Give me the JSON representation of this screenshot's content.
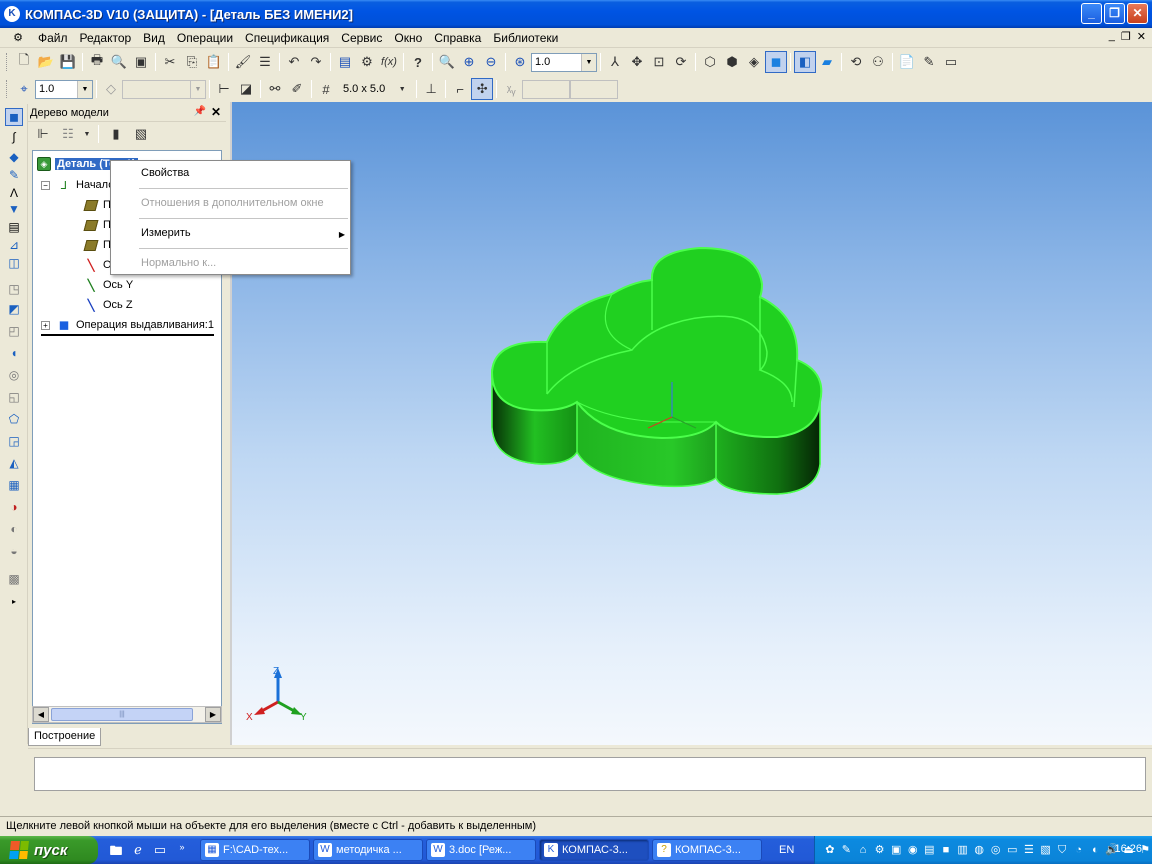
{
  "window": {
    "title": "КОМПАС-3D V10 (ЗАЩИТА) - [Деталь БЕЗ ИМЕНИ2]",
    "app_icon": "K"
  },
  "menu": {
    "items": [
      "Файл",
      "Редактор",
      "Вид",
      "Операции",
      "Спецификация",
      "Сервис",
      "Окно",
      "Справка",
      "Библиотеки"
    ]
  },
  "toolbar": {
    "scale_value": "1.0",
    "step_value": "1.0",
    "grid_value": "5.0 x 5.0",
    "fx_label": "f(x)",
    "help_label": "?"
  },
  "tree_panel": {
    "header": "Дерево модели",
    "tab_label": "Построение",
    "nodes": {
      "detail": "Деталь (Тел-1)",
      "origin": "Начало координат",
      "axis_y": "Ось Y",
      "axis_z": "Ось Z",
      "extrude": "Операция выдавливания:1",
      "plane_label": "П",
      "axis_x_label": "О"
    }
  },
  "context_menu": {
    "items": [
      {
        "label": "Свойства",
        "enabled": true
      },
      {
        "label": "Отношения в дополнительном окне",
        "enabled": false
      },
      {
        "label": "Измерить",
        "enabled": true,
        "submenu": true
      },
      {
        "label": "Нормально к...",
        "enabled": false
      }
    ]
  },
  "viewport": {
    "axis_x": "X",
    "axis_y": "Y",
    "axis_z": "Z",
    "part_color": "#1ed11e",
    "edge_color": "#4bff4b"
  },
  "status": {
    "text": "Щелкните левой кнопкой мыши на объекте для его выделения (вместе с Ctrl - добавить к выделенным)"
  },
  "taskbar": {
    "start_label": "пуск",
    "lang": "EN",
    "clock": "16:26",
    "tasks": [
      {
        "label": "F:\\CAD-тех...",
        "icon": "folder-icon",
        "active": false
      },
      {
        "label": "методичка ...",
        "icon": "word-icon",
        "active": false
      },
      {
        "label": "3.doc [Реж...",
        "icon": "word-icon",
        "active": false
      },
      {
        "label": "КОМПАС-3...",
        "icon": "kompas-icon",
        "active": true
      },
      {
        "label": "КОМПАС-3...",
        "icon": "help-icon",
        "active": false
      }
    ]
  }
}
